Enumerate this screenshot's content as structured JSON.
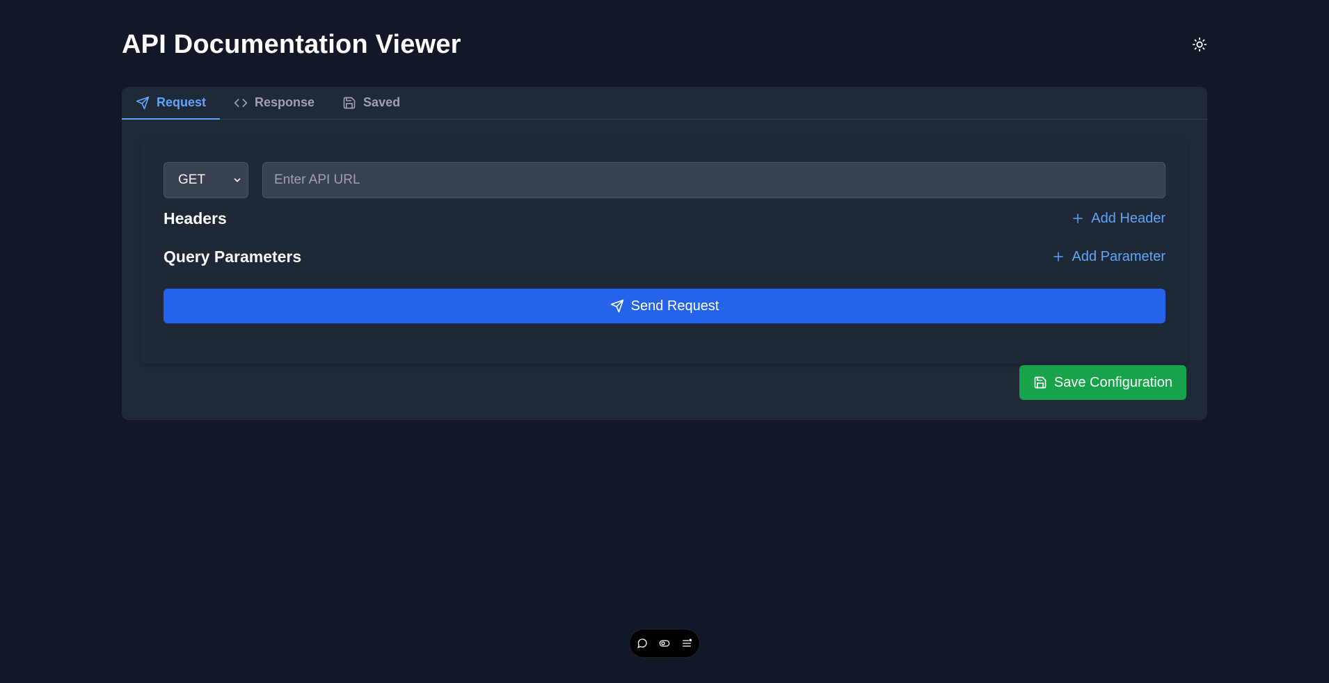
{
  "app": {
    "title": "API Documentation Viewer"
  },
  "header": {
    "theme_toggle_icon": "sun-icon"
  },
  "tabs": [
    {
      "label": "Request",
      "icon": "send-icon",
      "active": true
    },
    {
      "label": "Response",
      "icon": "code-icon",
      "active": false
    },
    {
      "label": "Saved",
      "icon": "save-icon",
      "active": false
    }
  ],
  "request": {
    "method": {
      "selected": "GET",
      "options": [
        "GET"
      ]
    },
    "url": {
      "value": "",
      "placeholder": "Enter API URL"
    },
    "headers": {
      "title": "Headers",
      "add_label": "Add Header"
    },
    "query_params": {
      "title": "Query Parameters",
      "add_label": "Add Parameter"
    },
    "send_label": "Send Request"
  },
  "save_label": "Save Configuration",
  "toolbar": {
    "icons": [
      "chat-icon",
      "toggle-icon",
      "list-icon"
    ]
  },
  "colors": {
    "background": "#111827",
    "card": "#1f2937",
    "accent": "#60a5fa",
    "primary_button": "#2563eb",
    "success_button": "#16a34a"
  }
}
